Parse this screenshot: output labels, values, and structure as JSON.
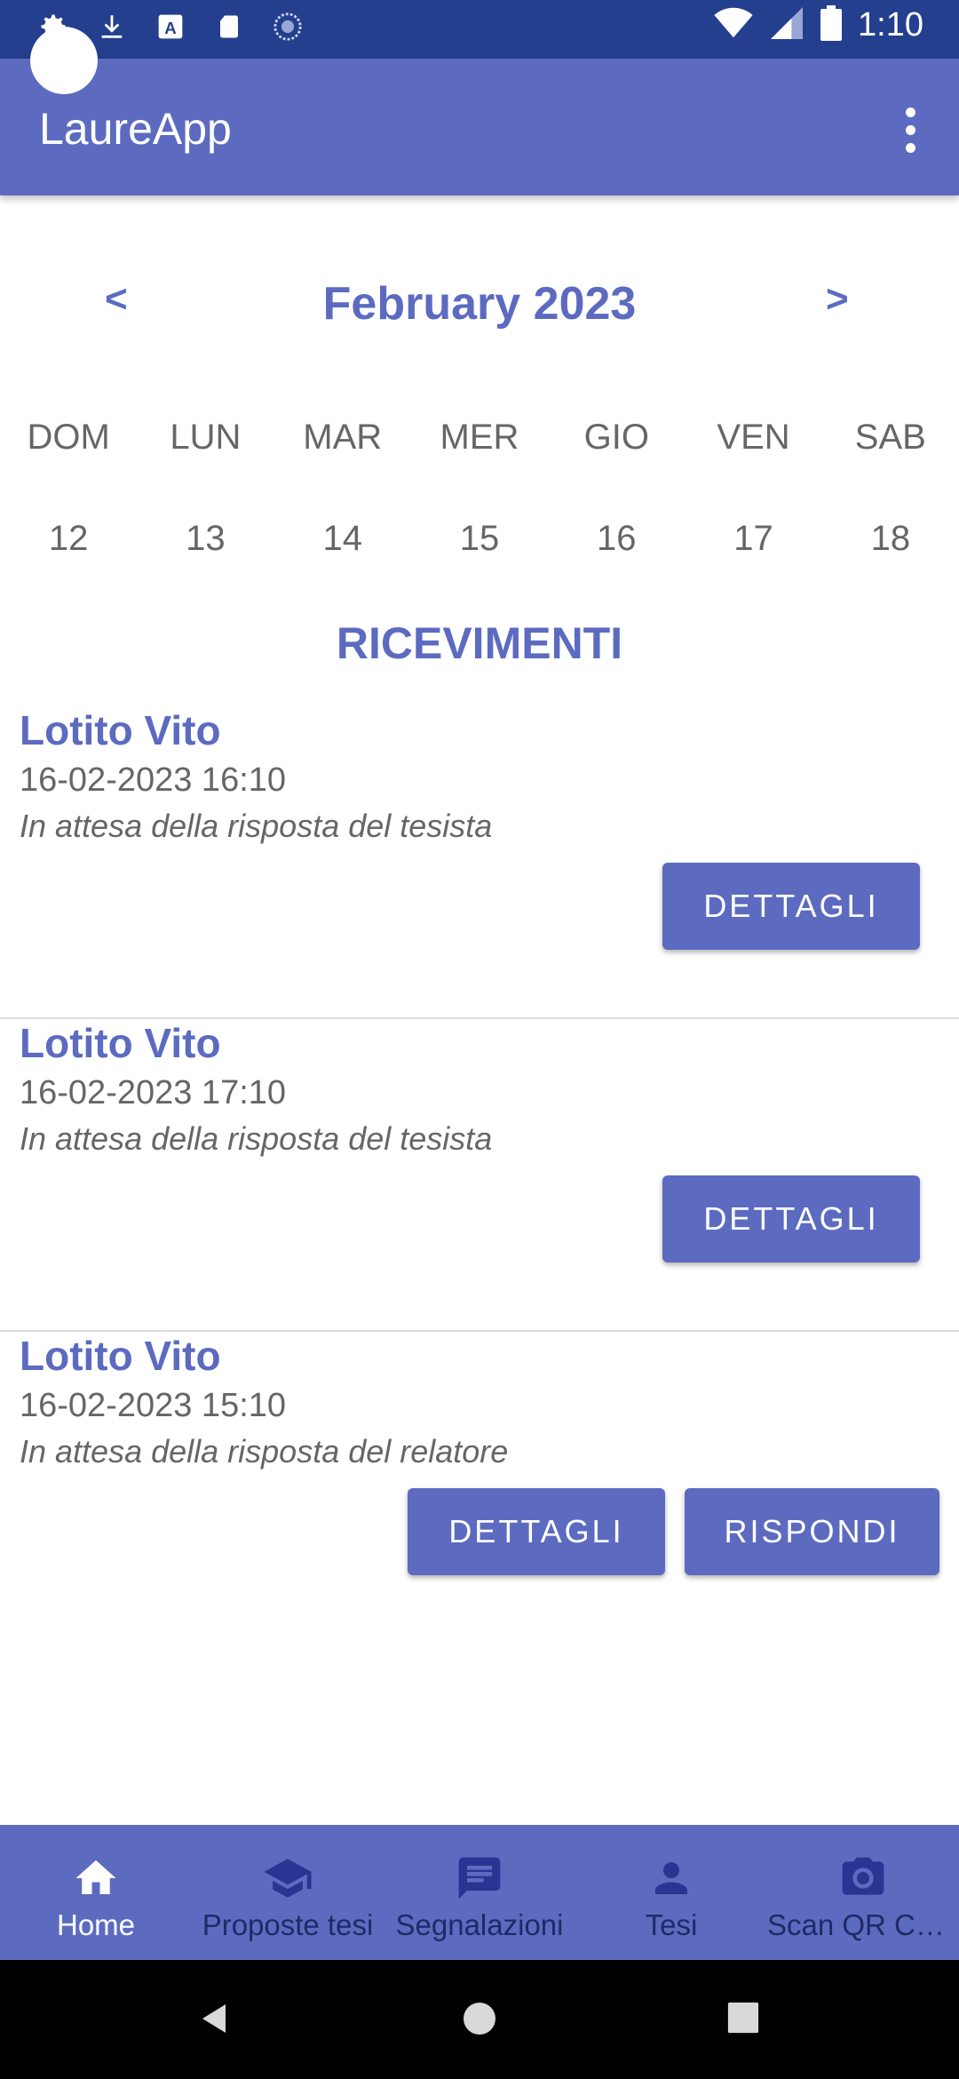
{
  "status_bar": {
    "time": "1:10"
  },
  "app_bar": {
    "title": "LaureApp"
  },
  "calendar": {
    "prev_label": "<",
    "next_label": ">",
    "month_title": "February 2023",
    "weekdays": [
      "DOM",
      "LUN",
      "MAR",
      "MER",
      "GIO",
      "VEN",
      "SAB"
    ],
    "dates": [
      "12",
      "13",
      "14",
      "15",
      "16",
      "17",
      "18"
    ]
  },
  "section": {
    "title": "RICEVIMENTI"
  },
  "receptions": [
    {
      "name": "Lotito Vito",
      "datetime": "16-02-2023 16:10",
      "status": "In attesa della risposta del tesista",
      "details_label": "DETTAGLI"
    },
    {
      "name": "Lotito Vito",
      "datetime": "16-02-2023 17:10",
      "status": "In attesa della risposta del tesista",
      "details_label": "DETTAGLI"
    },
    {
      "name": "Lotito Vito",
      "datetime": "16-02-2023 15:10",
      "status": "In attesa della risposta del relatore",
      "details_label": "DETTAGLI",
      "reply_label": "RISPONDI"
    }
  ],
  "bottom_nav": {
    "items": [
      {
        "label": "Home",
        "icon": "home-icon"
      },
      {
        "label": "Proposte tesi",
        "icon": "graduation-cap-icon"
      },
      {
        "label": "Segnalazioni",
        "icon": "message-icon"
      },
      {
        "label": "Tesi",
        "icon": "person-icon"
      },
      {
        "label": "Scan QR Co…",
        "icon": "camera-icon"
      }
    ]
  },
  "colors": {
    "primary": "#5c6bc0",
    "status_bar": "#233f8e",
    "nav_inactive": "#283593"
  }
}
